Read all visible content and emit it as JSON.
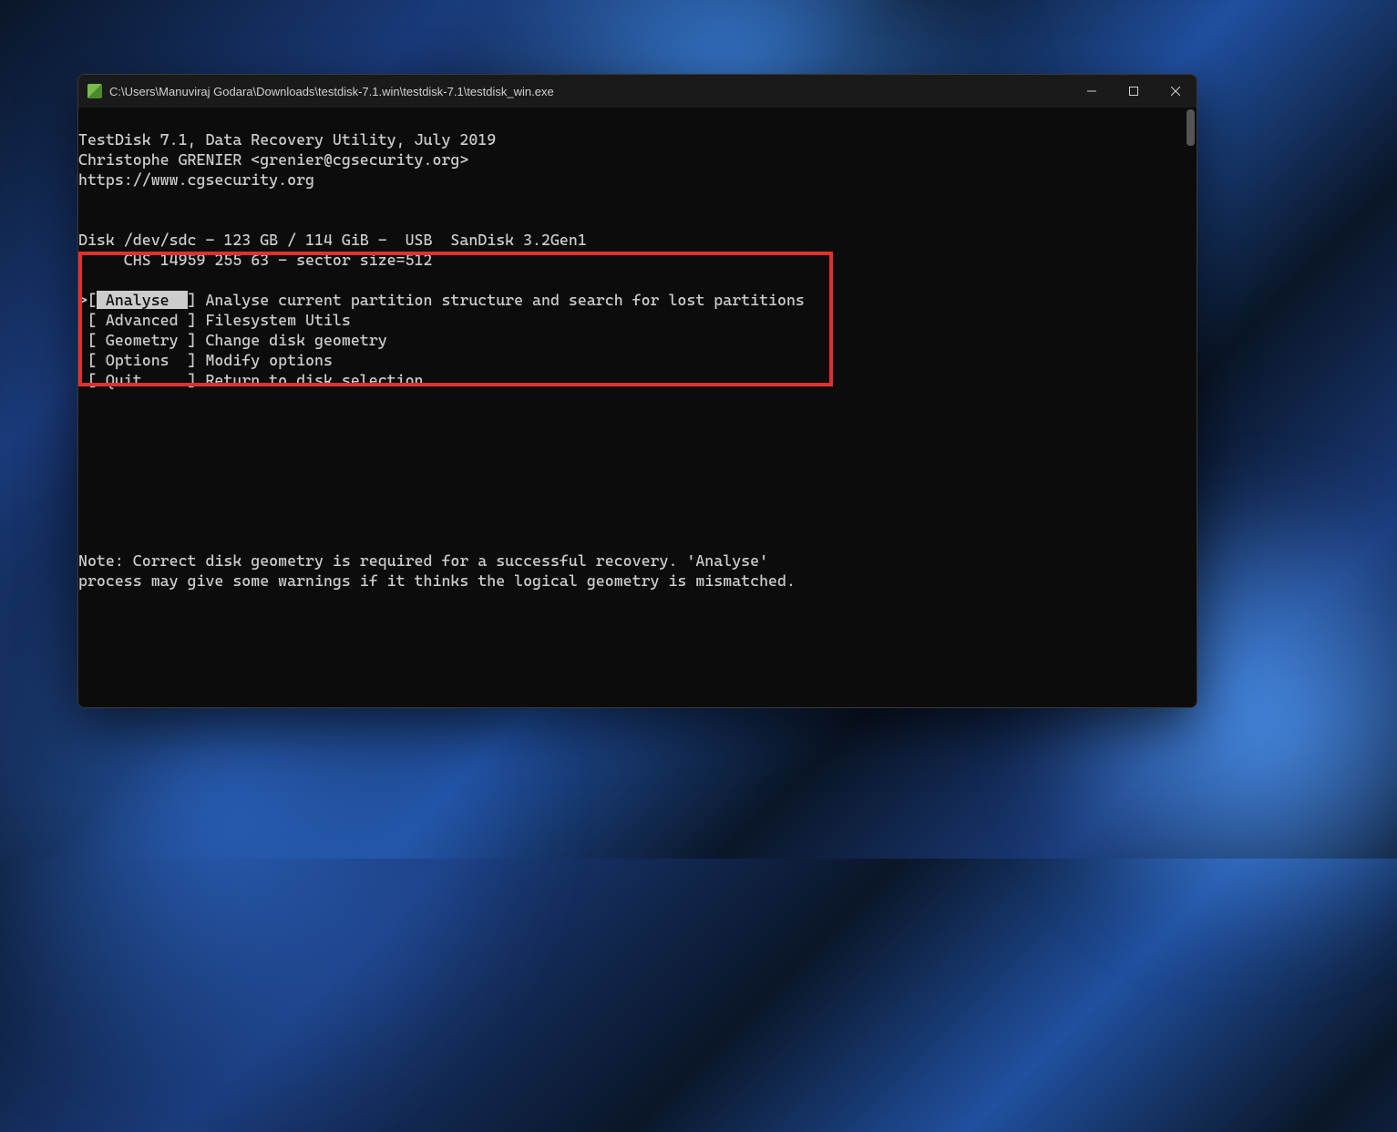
{
  "window": {
    "title": "C:\\Users\\Manuviraj Godara\\Downloads\\testdisk-7.1.win\\testdisk-7.1\\testdisk_win.exe"
  },
  "header": {
    "line1": "TestDisk 7.1, Data Recovery Utility, July 2019",
    "line2": "Christophe GRENIER <grenier@cgsecurity.org>",
    "line3": "https://www.cgsecurity.org"
  },
  "disk": {
    "line1": "Disk /dev/sdc - 123 GB / 114 GiB -  USB  SanDisk 3.2Gen1",
    "line2": "     CHS 14959 255 63 - sector size=512"
  },
  "menu": [
    {
      "selected": true,
      "label": " Analyse  ",
      "desc": "Analyse current partition structure and search for lost partitions"
    },
    {
      "selected": false,
      "label": " Advanced ",
      "desc": "Filesystem Utils"
    },
    {
      "selected": false,
      "label": " Geometry ",
      "desc": "Change disk geometry"
    },
    {
      "selected": false,
      "label": " Options  ",
      "desc": "Modify options"
    },
    {
      "selected": false,
      "label": " Quit     ",
      "desc": "Return to disk selection"
    }
  ],
  "note": {
    "line1": "Note: Correct disk geometry is required for a successful recovery. 'Analyse'",
    "line2": "process may give some warnings if it thinks the logical geometry is mismatched."
  },
  "highlight_color": "#e03030"
}
